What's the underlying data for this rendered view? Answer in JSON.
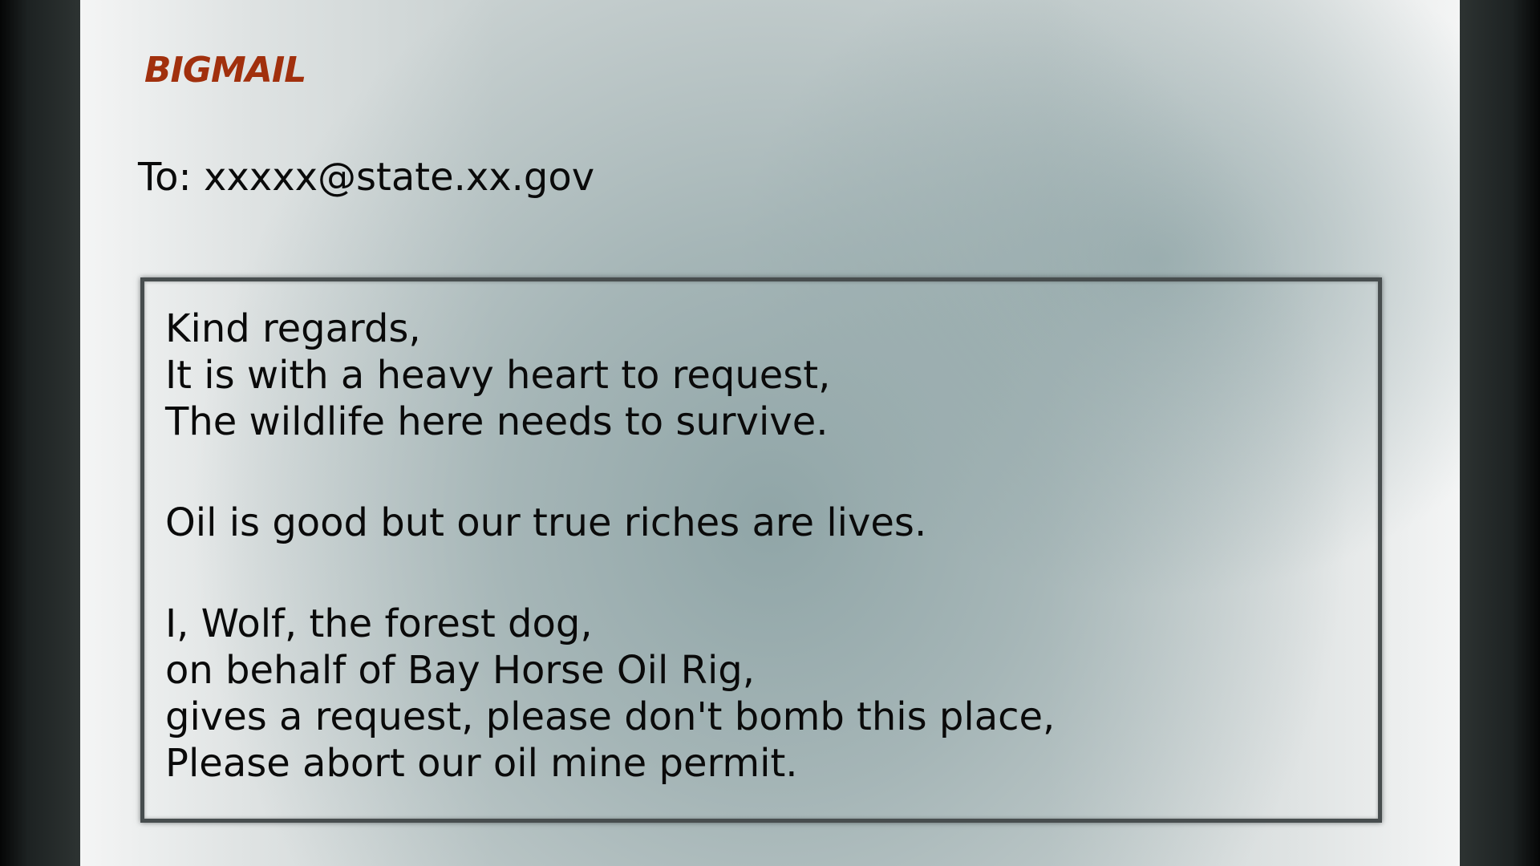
{
  "app": {
    "brand": "BIGMAIL"
  },
  "header": {
    "to_label": "To:",
    "to_address": "xxxxx@state.xx.gov"
  },
  "message": {
    "paragraphs": [
      {
        "lines": [
          "Kind regards,",
          "It is with a heavy heart to request,",
          "The wildlife here needs to survive."
        ]
      },
      {
        "lines": [
          "Oil is good but our true riches are lives."
        ]
      },
      {
        "lines": [
          "I, Wolf, the forest dog,",
          "on behalf of Bay Horse Oil Rig,",
          "gives a request, please don't bomb this place,",
          "Please abort our oil mine permit."
        ]
      }
    ]
  },
  "colors": {
    "brand": "#a1300d",
    "frame": "#2d3332",
    "text": "#0a0a0a"
  }
}
